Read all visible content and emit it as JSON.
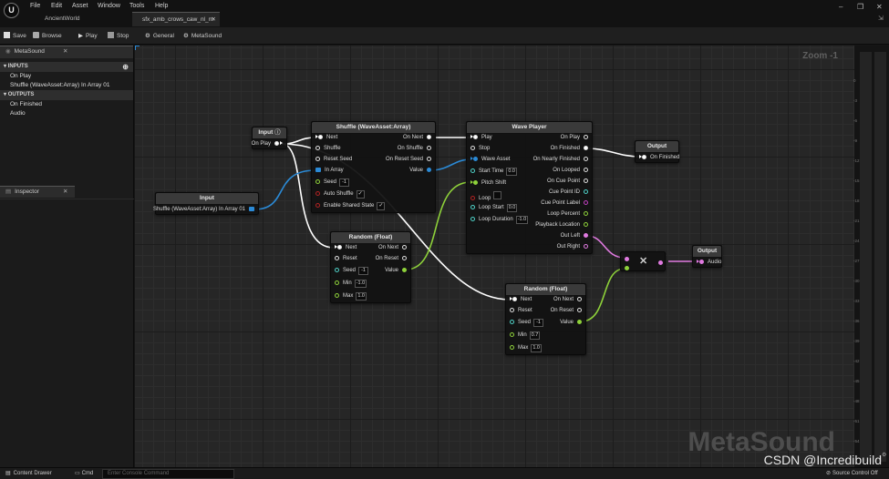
{
  "menu": [
    "File",
    "Edit",
    "Asset",
    "Window",
    "Tools",
    "Help"
  ],
  "project_name": "AncientWorld",
  "document_tab": "sfx_amb_crows_caw_nl_m",
  "toolbar": {
    "save": "Save",
    "browse": "Browse",
    "play": "Play",
    "stop": "Stop",
    "general": "General",
    "metasound": "MetaSound"
  },
  "metasound_panel": {
    "tab": "MetaSound",
    "inputs_header": "INPUTS",
    "inputs": [
      "On Play",
      "Shuffle (WaveAsset:Array) In Array 01"
    ],
    "outputs_header": "OUTPUTS",
    "outputs": [
      "On Finished",
      "Audio"
    ]
  },
  "inspector_tab": "Inspector",
  "graph": {
    "zoom": "Zoom -1",
    "watermark": "MetaSound",
    "nodes": {
      "input_play": {
        "title": "Input",
        "pin": "On Play"
      },
      "input_array": {
        "title": "Input",
        "pin": "Shuffle (WaveAsset:Array) In Array 01"
      },
      "shuffle": {
        "title": "Shuffle (WaveAsset:Array)",
        "inputs": [
          "Next",
          "Shuffle",
          "Reset Seed",
          "In Array",
          "Seed",
          "Auto Shuffle",
          "Enable Shared State"
        ],
        "outputs": [
          "On Next",
          "On Shuffle",
          "On Reset Seed",
          "Value"
        ],
        "seed_value": "-1",
        "auto_shuffle_checked": "✓",
        "enable_shared_state_checked": "✓"
      },
      "wave_player": {
        "title": "Wave Player",
        "inputs": [
          "Play",
          "Stop",
          "Wave Asset",
          "Start Time",
          "Pitch Shift",
          "Loop",
          "Loop Start",
          "Loop Duration"
        ],
        "outputs": [
          "On Play",
          "On Finished",
          "On Nearly Finished",
          "On Looped",
          "On Cue Point",
          "Cue Point ID",
          "Cue Point Label",
          "Loop Percent",
          "Playback Location",
          "Out Left",
          "Out Right"
        ],
        "start_time": "0.0",
        "loop_start": "0.0",
        "loop_duration": "-1.0"
      },
      "random1": {
        "title": "Random (Float)",
        "inputs": [
          "Next",
          "Reset",
          "Seed",
          "Min",
          "Max"
        ],
        "outputs": [
          "On Next",
          "On Reset",
          "Value"
        ],
        "seed": "-1",
        "min": "-1.0",
        "max": "1.0"
      },
      "random2": {
        "title": "Random (Float)",
        "inputs": [
          "Next",
          "Reset",
          "Seed",
          "Min",
          "Max"
        ],
        "outputs": [
          "On Next",
          "On Reset",
          "Value"
        ],
        "seed": "-1",
        "min": "0.7",
        "max": "1.0"
      },
      "output_finished": {
        "title": "Output",
        "pin": "On Finished"
      },
      "output_audio": {
        "title": "Output",
        "pin": "Audio"
      },
      "multiply_symbol": "✕"
    },
    "colors": {
      "trigger": "#ffffff",
      "float": "#8ed13a",
      "wave": "#2b8ad6",
      "audio": "#e07ae0"
    }
  },
  "meter_ticks": [
    "0",
    "-3",
    "-6",
    "-9",
    "-12",
    "-15",
    "-18",
    "-21",
    "-24",
    "-27",
    "-30",
    "-33",
    "-36",
    "-39",
    "-42",
    "-45",
    "-48",
    "-51",
    "-54"
  ],
  "statusbar": {
    "content_drawer": "Content Drawer",
    "cmd": "Cmd",
    "console_placeholder": "Enter Console Command",
    "source_control": "Source Control Off"
  },
  "watermark_csdn": "CSDN @Incredibuild"
}
